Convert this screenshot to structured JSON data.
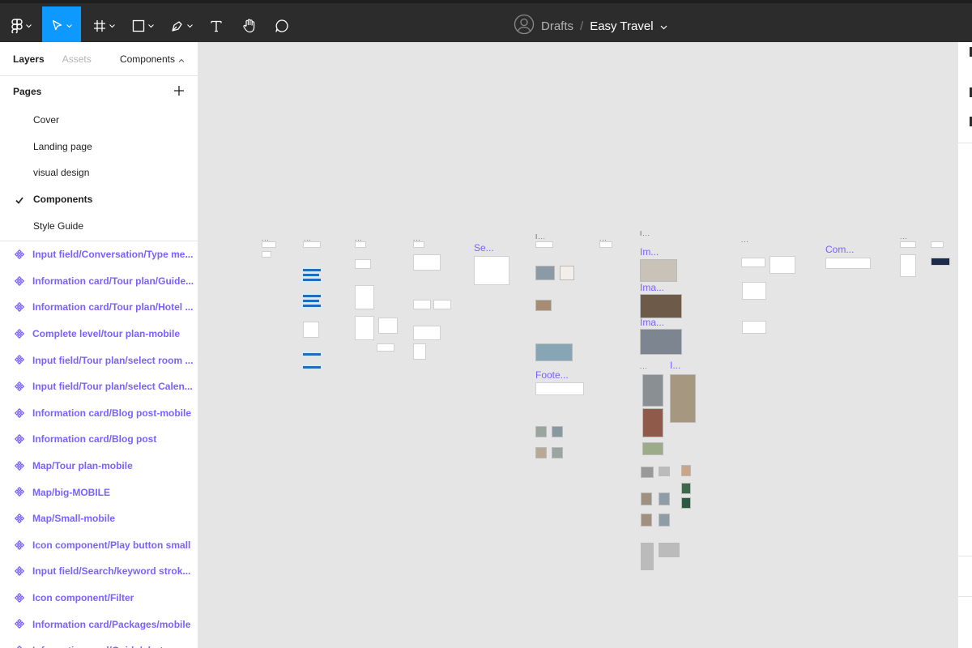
{
  "toolbar": {
    "tools": [
      {
        "name": "main-menu",
        "icon": "figma-logo-icon"
      },
      {
        "name": "move-tool",
        "icon": "cursor-arrow-icon",
        "active": true
      },
      {
        "name": "frame-tool",
        "icon": "hash-frame-icon"
      },
      {
        "name": "shape-tool",
        "icon": "rectangle-icon"
      },
      {
        "name": "pen-tool",
        "icon": "pen-nib-icon"
      },
      {
        "name": "text-tool",
        "icon": "text-t-icon"
      },
      {
        "name": "hand-tool",
        "icon": "hand-icon"
      },
      {
        "name": "comment-tool",
        "icon": "speech-bubble-icon"
      }
    ],
    "active_color": "#0d99ff"
  },
  "file": {
    "folder": "Drafts",
    "separator": "/",
    "name": "Easy Travel"
  },
  "panel": {
    "tabs": {
      "layers": "Layers",
      "assets": "Assets"
    },
    "library": "Components",
    "pages_title": "Pages",
    "pages": [
      {
        "label": "Cover",
        "current": false
      },
      {
        "label": "Landing page",
        "current": false
      },
      {
        "label": "visual design",
        "current": false
      },
      {
        "label": "Components",
        "current": true
      },
      {
        "label": "Style Guide",
        "current": false
      }
    ],
    "layers": [
      "Input field/Conversation/Type me...",
      "Information card/Tour plan/Guide...",
      "Information card/Tour plan/Hotel ...",
      "Complete level/tour plan-mobile",
      "Input field/Tour plan/select room ...",
      "Input field/Tour plan/select Calen...",
      "Information card/Blog post-mobile",
      "Information card/Blog post",
      "Map/Tour plan-mobile",
      "Map/big-MOBILE",
      "Map/Small-mobile",
      "Icon component/Play button small",
      "Input field/Search/keyword strok...",
      "Icon component/Filter",
      "Information card/Packages/mobile",
      "Information card/Guide/photo an..."
    ],
    "component_color": "#7b61ff"
  },
  "canvas": {
    "background": "#e5e5e5",
    "labels": {
      "se": "Se...",
      "im1": "Im...",
      "ima1": "Ima...",
      "ima2": "Ima...",
      "footer": "Foote...",
      "com": "Com...",
      "dots": "...",
      "i1": "I...",
      "l1": "I...",
      "l2": "I..."
    }
  }
}
